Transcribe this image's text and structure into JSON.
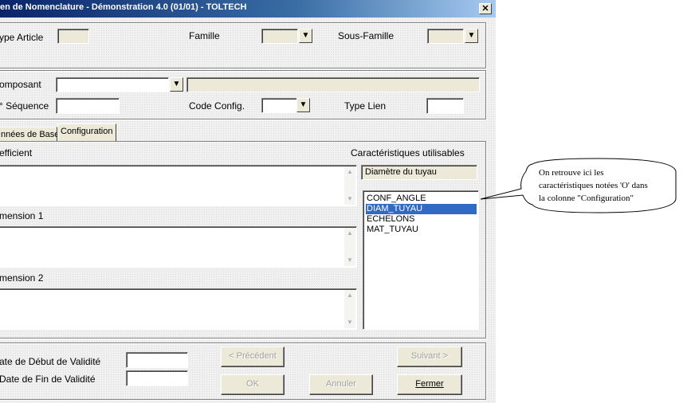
{
  "window": {
    "title": "en de Nomenclature - Démonstration 4.0 (01/01) - TOLTECH",
    "close_glyph": "✕"
  },
  "header": {
    "type_article_label": "ype Article",
    "famille_label": "Famille",
    "sous_famille_label": "Sous-Famille"
  },
  "component": {
    "composant_label": "omposant",
    "sequence_label": "° Séquence",
    "code_config_label": "Code Config.",
    "type_lien_label": "Type Lien"
  },
  "tabs": [
    {
      "label": "nnées de Base"
    },
    {
      "label": "Configuration"
    }
  ],
  "config": {
    "coefficient_label": "efficient",
    "dimension1_label": "mension 1",
    "dimension2_label": "mension 2",
    "caracteristiques_label": "Caractéristiques utilisables",
    "selected_characteristic": "Diamètre du tuyau",
    "characteristics": [
      "CONF_ANGLE",
      "DIAM_TUYAU",
      "ECHELONS",
      "MAT_TUYAU"
    ],
    "selected_index": 1
  },
  "validity": {
    "debut_label": "ate de Début de Validité",
    "fin_label": "Date de Fin de Validité"
  },
  "buttons": {
    "precedent": "< Précédent",
    "suivant": "Suivant >",
    "ok": "OK",
    "annuler": "Annuler",
    "fermer": "Fermer"
  },
  "callout": {
    "lines": [
      "On retrouve ici les",
      "caractéristiques notées 'O' dans",
      "la colonne \"Configuration\""
    ]
  },
  "icons": {
    "dropdown": "dropdown-arrow-icon",
    "scroll_up": "scroll-up-icon",
    "scroll_down": "scroll-down-icon",
    "close": "close-icon"
  }
}
